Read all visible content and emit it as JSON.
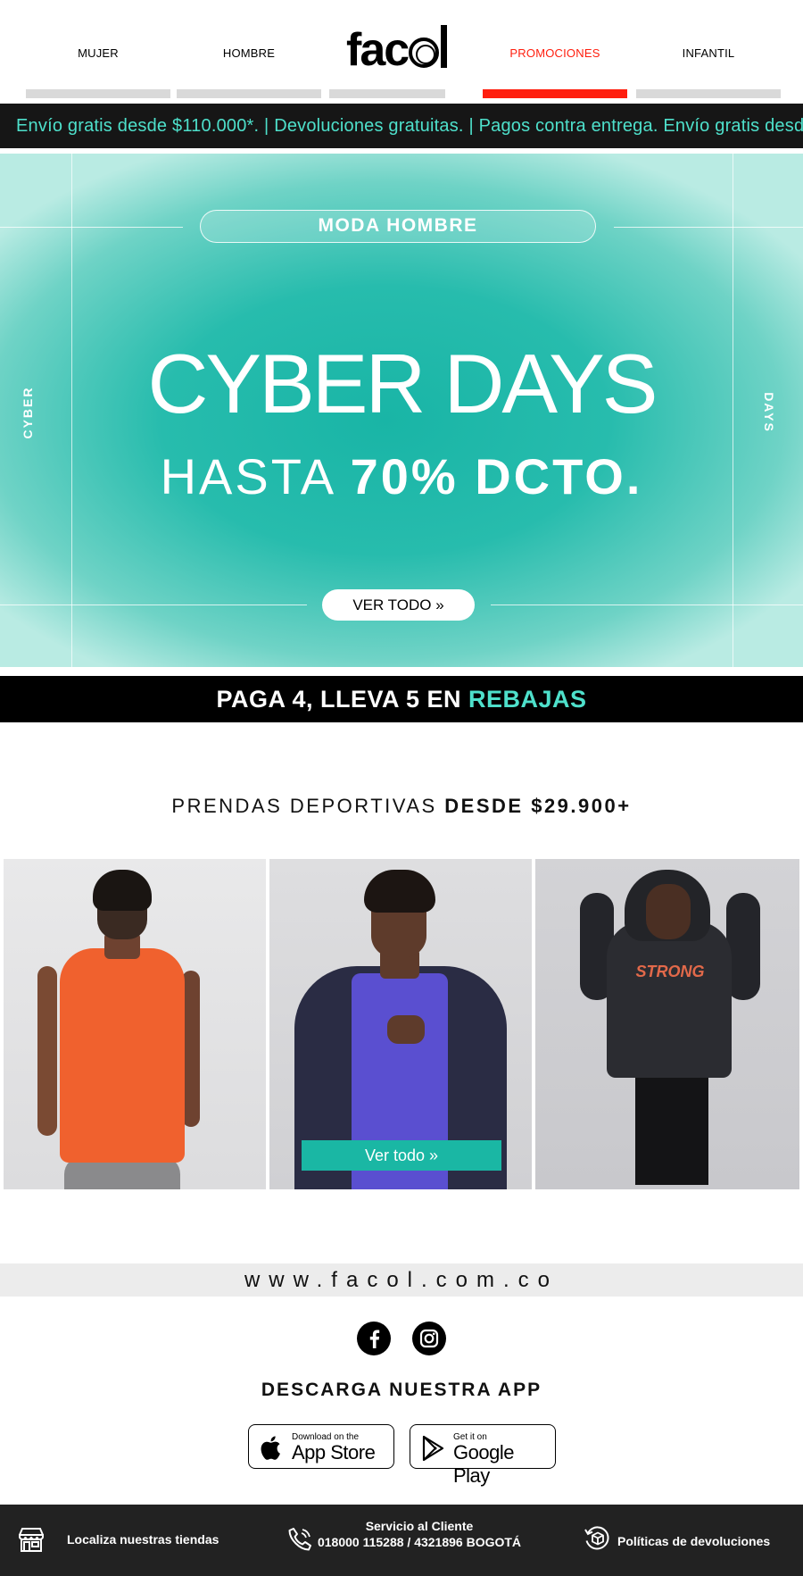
{
  "nav": {
    "items": [
      {
        "label": "MUJER",
        "active": false
      },
      {
        "label": "HOMBRE",
        "active": false
      },
      {
        "label": "PROMOCIONES",
        "active": true
      },
      {
        "label": "INFANTIL",
        "active": false
      }
    ],
    "logo": {
      "part1": "fac",
      "part2": "l"
    },
    "active_color": "#ff1e0e"
  },
  "ticker": {
    "text": "Envío gratis desde $110.000*.  |  Devoluciones gratuitas.  |  Pagos contra entrega.  Envío gratis desde $110.000*."
  },
  "hero": {
    "pill_label": "MODA HOMBRE",
    "side_left": "CYBER",
    "side_right": "DAYS",
    "title": "CYBER DAYS",
    "subtitle_light": "HASTA ",
    "subtitle_bold": "70% DCTO.",
    "button_label": "VER TODO »"
  },
  "promo": {
    "text": "PAGA 4, LLEVA 5 EN ",
    "accent": "REBAJAS",
    "accent_color": "#4ee0cb"
  },
  "section": {
    "title_light": "PRENDAS DEPORTIVAS ",
    "title_bold": "DESDE $29.900+"
  },
  "products": {
    "cta_label": "Ver todo »",
    "photos": [
      "orange-tank-top-photo",
      "navy-jacket-photo",
      "black-hoodie-photo"
    ],
    "hoodie_print": "STRONG"
  },
  "site_url": "www.facol.com.co",
  "social": [
    "facebook-icon",
    "instagram-icon"
  ],
  "app": {
    "title": "DESCARGA NUESTRA APP",
    "app_store": {
      "small": "Download on the",
      "big": "App Store"
    },
    "google_play": {
      "small": "Get it on",
      "big": "Google Play"
    }
  },
  "footer": {
    "stores": "Localiza nuestras tiendas",
    "service_title": "Servicio al Cliente",
    "service_phone": "018000 115288 / 4321896 BOGOTÁ",
    "returns": "Políticas de devoluciones"
  },
  "colors": {
    "teal": "#1ab7a4",
    "mint_text": "#4ee0cb",
    "footer_bg": "#222222"
  }
}
